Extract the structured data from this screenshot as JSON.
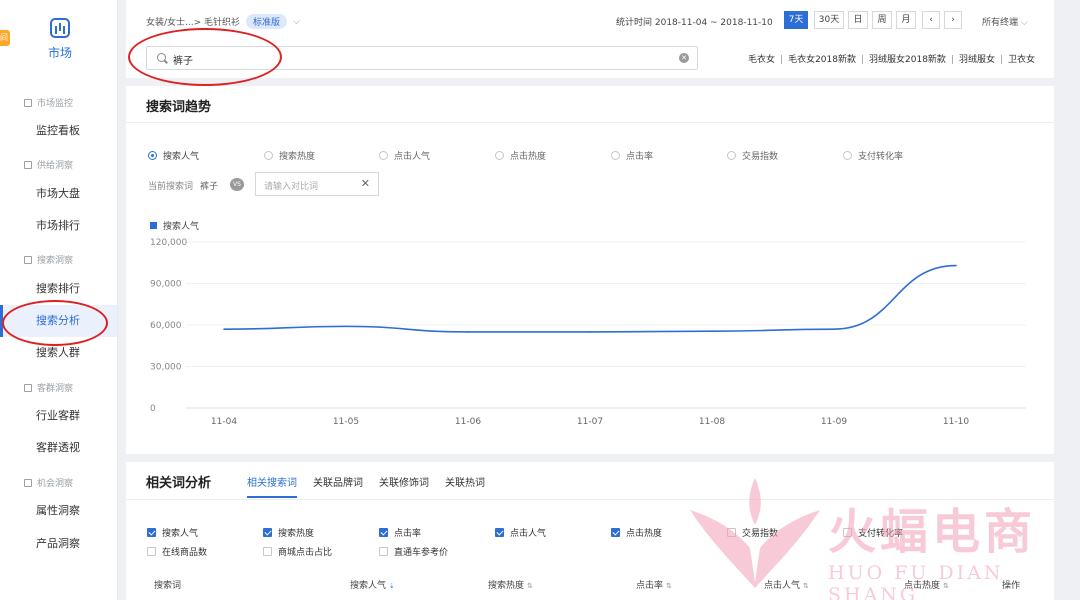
{
  "sidebar": {
    "side_tab": "间",
    "market_label": "市场",
    "groups": [
      {
        "label": "市场监控",
        "items": [
          "监控看板"
        ]
      },
      {
        "label": "供给洞察",
        "items": [
          "市场大盘",
          "市场排行"
        ]
      },
      {
        "label": "搜索洞察",
        "items": [
          "搜索排行",
          "搜索分析",
          "搜索人群"
        ]
      },
      {
        "label": "客群洞察",
        "items": [
          "行业客群",
          "客群透视"
        ]
      },
      {
        "label": "机会洞察",
        "items": [
          "属性洞察",
          "产品洞察"
        ]
      }
    ],
    "active_item": "搜索分析"
  },
  "header": {
    "category_path": "女装/女士...> 毛针织衫",
    "edition_badge": "标准版",
    "stat_time": "统计时间 2018-11-04 ~ 2018-11-10",
    "periods": [
      "7天",
      "30天",
      "日",
      "周",
      "月"
    ],
    "active_period": "7天",
    "prev": "‹",
    "next": "›",
    "terminal": "所有终端",
    "search_value": "裤子",
    "search_placeholder": "",
    "quick_words": [
      "毛衣女",
      "毛衣女2018新款",
      "羽绒服女2018新款",
      "羽绒服女",
      "卫衣女"
    ]
  },
  "trend": {
    "title": "搜索词趋势",
    "metrics": [
      "搜索人气",
      "搜索热度",
      "点击人气",
      "点击热度",
      "点击率",
      "交易指数",
      "支付转化率"
    ],
    "selected_metric": "搜索人气",
    "compare_label": "当前搜索词",
    "compare_word": "裤子",
    "vs": "VS",
    "compare_placeholder": "请输入对比词",
    "compare_clear": "✕"
  },
  "chart_data": {
    "type": "line",
    "title": "",
    "xlabel": "",
    "ylabel": "",
    "x": [
      "11-04",
      "11-05",
      "11-06",
      "11-07",
      "11-08",
      "11-09",
      "11-10"
    ],
    "series": [
      {
        "name": "搜索人气",
        "values": [
          57000,
          59000,
          55000,
          55000,
          55500,
          57000,
          103000
        ],
        "color": "#2c6ed5"
      }
    ],
    "yticks": [
      "120,000",
      "90,000",
      "60,000",
      "30,000",
      "0"
    ],
    "ylim": [
      0,
      120000
    ],
    "grid": true,
    "legend": "top-left"
  },
  "related": {
    "title": "相关词分析",
    "tabs": [
      "相关搜索词",
      "关联品牌词",
      "关联修饰词",
      "关联热词"
    ],
    "active_tab": "相关搜索词",
    "checkboxes": [
      {
        "label": "搜索人气",
        "checked": true
      },
      {
        "label": "搜索热度",
        "checked": true
      },
      {
        "label": "点击率",
        "checked": true
      },
      {
        "label": "点击人气",
        "checked": true
      },
      {
        "label": "点击热度",
        "checked": true
      },
      {
        "label": "交易指数",
        "checked": false
      },
      {
        "label": "支付转化率",
        "checked": false
      },
      {
        "label": "在线商品数",
        "checked": false
      },
      {
        "label": "商城点击占比",
        "checked": false
      },
      {
        "label": "直通车参考价",
        "checked": false
      }
    ],
    "columns": [
      "搜索词",
      "搜索人气",
      "搜索热度",
      "点击率",
      "点击人气",
      "点击热度",
      "操作"
    ]
  },
  "watermark": {
    "brand": "火蝠电商",
    "pinyin": "HUO FU DIAN SHANG",
    "color": "#f4a0b8"
  },
  "colors": {
    "accent": "#2c6ed5",
    "annotation": "#e02020"
  }
}
